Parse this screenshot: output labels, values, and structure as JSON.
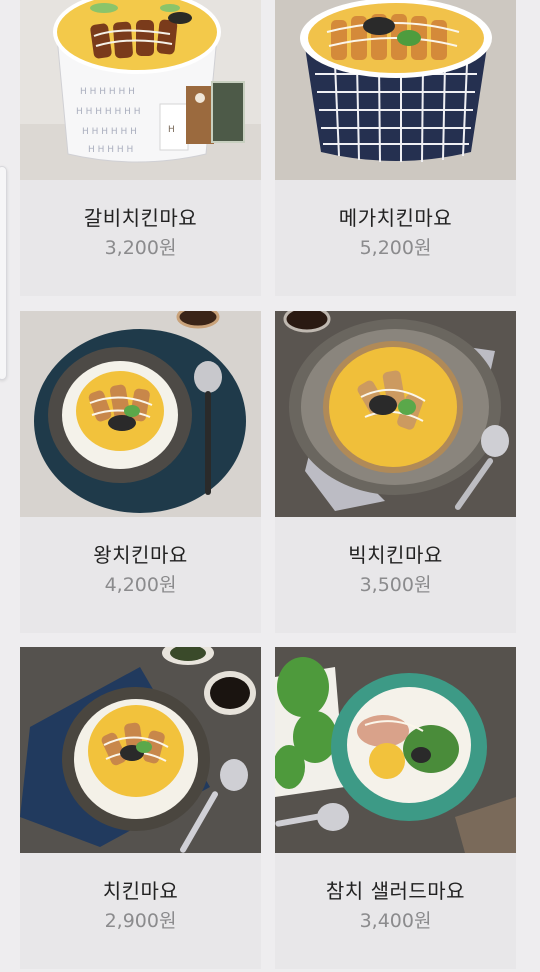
{
  "menu": {
    "items": [
      {
        "name": "갈비치킨마요",
        "price": "3,200원",
        "packet_label": "H"
      },
      {
        "name": "메가치킨마요",
        "price": "5,200원"
      },
      {
        "name": "왕치킨마요",
        "price": "4,200원"
      },
      {
        "name": "빅치킨마요",
        "price": "3,500원"
      },
      {
        "name": "치킨마요",
        "price": "2,900원"
      },
      {
        "name": "참치 샐러드마요",
        "price": "3,400원"
      }
    ]
  },
  "colors": {
    "page_bg": "#eeedef",
    "card_bg": "#e8e7e9",
    "name_text": "#222222",
    "price_text": "#8b8b8d"
  }
}
